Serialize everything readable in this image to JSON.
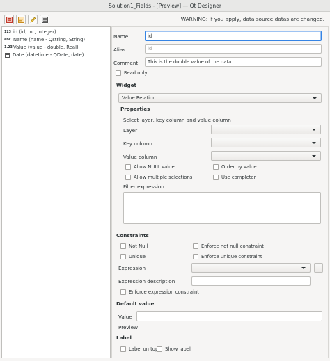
{
  "window": {
    "title": "Solution1_Fields - [Preview] — Qt Designer"
  },
  "toolbar": {
    "buttons": [
      {
        "icon": "form-icon"
      },
      {
        "icon": "new-icon"
      },
      {
        "icon": "edit-pencil-icon"
      },
      {
        "icon": "field-layout-icon"
      }
    ],
    "warning": "WARNING: If you apply, data source datas are changed."
  },
  "fields": [
    {
      "type_badge": "123",
      "label": "id (id, int, integer)"
    },
    {
      "type_badge": "abc",
      "label": "Name (name - Qstring, String)"
    },
    {
      "type_badge": "1.23",
      "label": "Value (value - double, Real)"
    },
    {
      "type_badge": "",
      "label": "Date (datetime - QDate, date)"
    }
  ],
  "form": {
    "name_label": "Name",
    "name_value": "id",
    "alias_label": "Alias",
    "alias_placeholder": "id",
    "comment_label": "Comment",
    "comment_value": "This is the double value of the data",
    "read_only_label": "Read only"
  },
  "widget": {
    "section_title": "Widget",
    "type_value": "Value Relation",
    "properties_title": "Properties",
    "instruction": "Select layer, key column and value column",
    "layer_label": "Layer",
    "key_column_label": "Key column",
    "value_column_label": "Value column",
    "allow_null_label": "Allow NULL value",
    "order_by_value_label": "Order by value",
    "allow_multiple_label": "Allow multiple selections",
    "use_completer_label": "Use completer",
    "filter_expression_label": "Filter expression"
  },
  "constraints": {
    "section_title": "Constraints",
    "not_null_label": "Not Null",
    "enforce_not_null_label": "Enforce not null constraint",
    "unique_label": "Unique",
    "enforce_unique_label": "Enforce unique constraint",
    "expression_label": "Expression",
    "expression_button": "...",
    "expression_description_label": "Expression description",
    "enforce_expression_label": "Enforce expression constraint"
  },
  "default_value": {
    "section_title": "Default value",
    "value_label": "Value",
    "preview_label": "Preview"
  },
  "label_section": {
    "section_title": "Label",
    "label_on_top": "Label on top",
    "show_label": "Show label"
  },
  "colors": {
    "focus_border": "#3584e4",
    "window_bg": "#f6f5f4",
    "input_border": "#c0bfbc"
  }
}
